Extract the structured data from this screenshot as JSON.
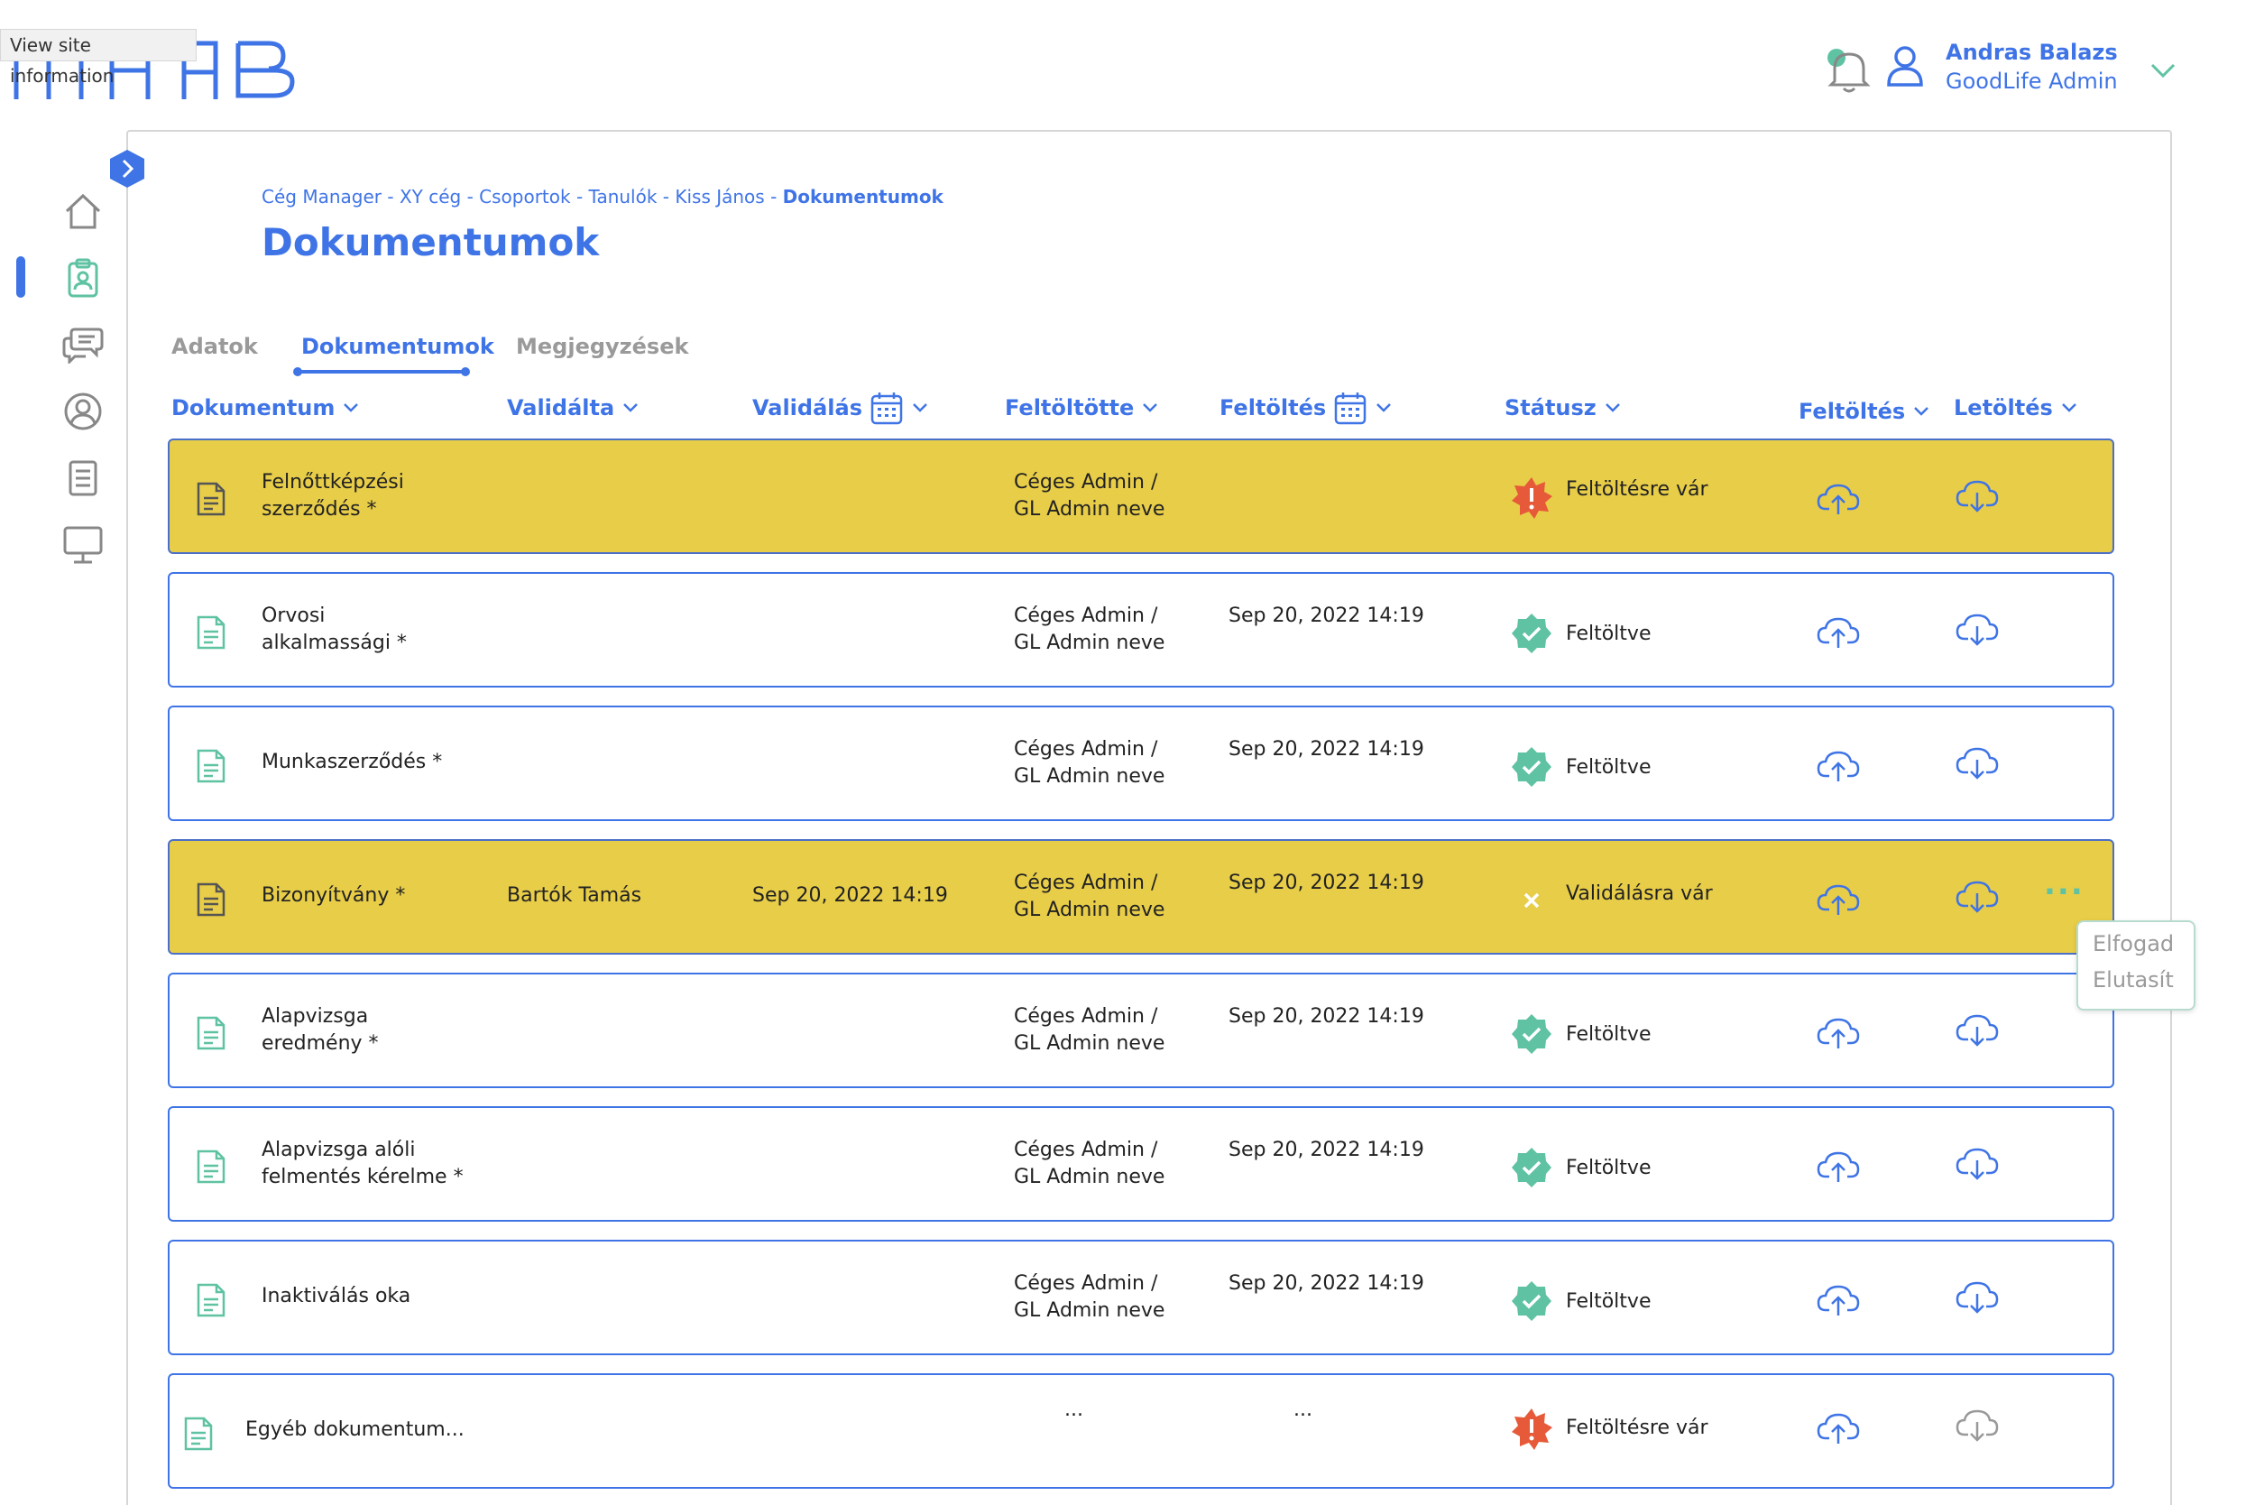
{
  "browser": {
    "tooltip": "View site information"
  },
  "logo": {
    "text": "MABI"
  },
  "user": {
    "name": "Andras Balazs",
    "role": "GoodLife Admin"
  },
  "breadcrumb": {
    "items": [
      "Cég Manager",
      "XY cég",
      "Csoportok",
      "Tanulók",
      "Kiss János"
    ],
    "separator": "-",
    "current": "Dokumentumok"
  },
  "page": {
    "title": "Dokumentumok"
  },
  "tabs": [
    {
      "label": "Adatok"
    },
    {
      "label": "Dokumentumok",
      "active": true
    },
    {
      "label": "Megjegyzések"
    }
  ],
  "columns": {
    "dokumentum": "Dokumentum",
    "validalta": "Validálta",
    "validalas": "Validálás",
    "feltoltotte": "Feltöltötte",
    "feltoltes_date": "Feltöltés",
    "statusz": "Státusz",
    "feltoltes_action": "Feltöltés",
    "letoltes_action": "Letöltés"
  },
  "rows": [
    {
      "doc": [
        "Felnőttképzési",
        "szerződés  *"
      ],
      "validalta": "",
      "validalas": "",
      "uploader": [
        "Céges Admin /",
        "GL Admin neve"
      ],
      "date": "",
      "status": "Feltöltésre vár",
      "status_icon": "warning-badge-icon",
      "highlight": true
    },
    {
      "doc": [
        "Orvosi",
        "alkalmassági *"
      ],
      "validalta": "",
      "validalas": "",
      "uploader": [
        "Céges Admin /",
        "GL Admin neve"
      ],
      "date": "Sep 20, 2022 14:19",
      "status": "Feltöltve",
      "status_icon": "check-badge-icon",
      "highlight": false
    },
    {
      "doc": [
        "Munkaszerződés *"
      ],
      "validalta": "",
      "validalas": "",
      "uploader": [
        "Céges Admin /",
        "GL Admin neve"
      ],
      "date": "Sep 20, 2022 14:19",
      "status": "Feltöltve",
      "status_icon": "check-badge-icon",
      "highlight": false
    },
    {
      "doc": [
        "Bizonyítvány *"
      ],
      "validalta": "Bartók Tamás",
      "validalas": "Sep 20, 2022 14:19",
      "uploader": [
        "Céges Admin /",
        "GL Admin neve"
      ],
      "date": "Sep 20, 2022 14:19",
      "status": "Validálásra vár",
      "status_icon": "cross-icon",
      "highlight": true,
      "more": "..."
    },
    {
      "doc": [
        "Alapvizsga",
        "eredmény *"
      ],
      "validalta": "",
      "validalas": "",
      "uploader": [
        "Céges Admin /",
        "GL Admin neve"
      ],
      "date": "Sep 20, 2022 14:19",
      "status": "Feltöltve",
      "status_icon": "check-badge-icon",
      "highlight": false
    },
    {
      "doc": [
        "Alapvizsga alóli",
        "felmentés kérelme *"
      ],
      "validalta": "",
      "validalas": "",
      "uploader": [
        "Céges Admin /",
        "GL Admin neve"
      ],
      "date": "Sep 20, 2022 14:19",
      "status": "Feltöltve",
      "status_icon": "check-badge-icon",
      "highlight": false
    },
    {
      "doc": [
        "Inaktiválás oka"
      ],
      "validalta": "",
      "validalas": "",
      "uploader": [
        "Céges Admin /",
        "GL Admin neve"
      ],
      "date": "Sep 20, 2022 14:19",
      "status": "Feltöltve",
      "status_icon": "check-badge-icon",
      "highlight": false
    },
    {
      "doc": [
        "Egyéb dokumentum..."
      ],
      "validalta": "",
      "validalas": "",
      "uploader": [
        "..."
      ],
      "date": "...",
      "status": "Feltöltésre vár",
      "status_icon": "warning-badge-icon",
      "highlight": false
    }
  ],
  "popup": {
    "accept": "Elfogad",
    "reject": "Elutasít"
  },
  "sidebar_icons": [
    "home-icon",
    "clipboard-user-icon",
    "chat-icon",
    "user-circle-icon",
    "document-list-icon",
    "monitor-icon"
  ],
  "colors": {
    "accent": "#3f74e6",
    "highlight": "#e8cd48",
    "success": "#5fc2a3",
    "warning": "#e65a3a"
  }
}
